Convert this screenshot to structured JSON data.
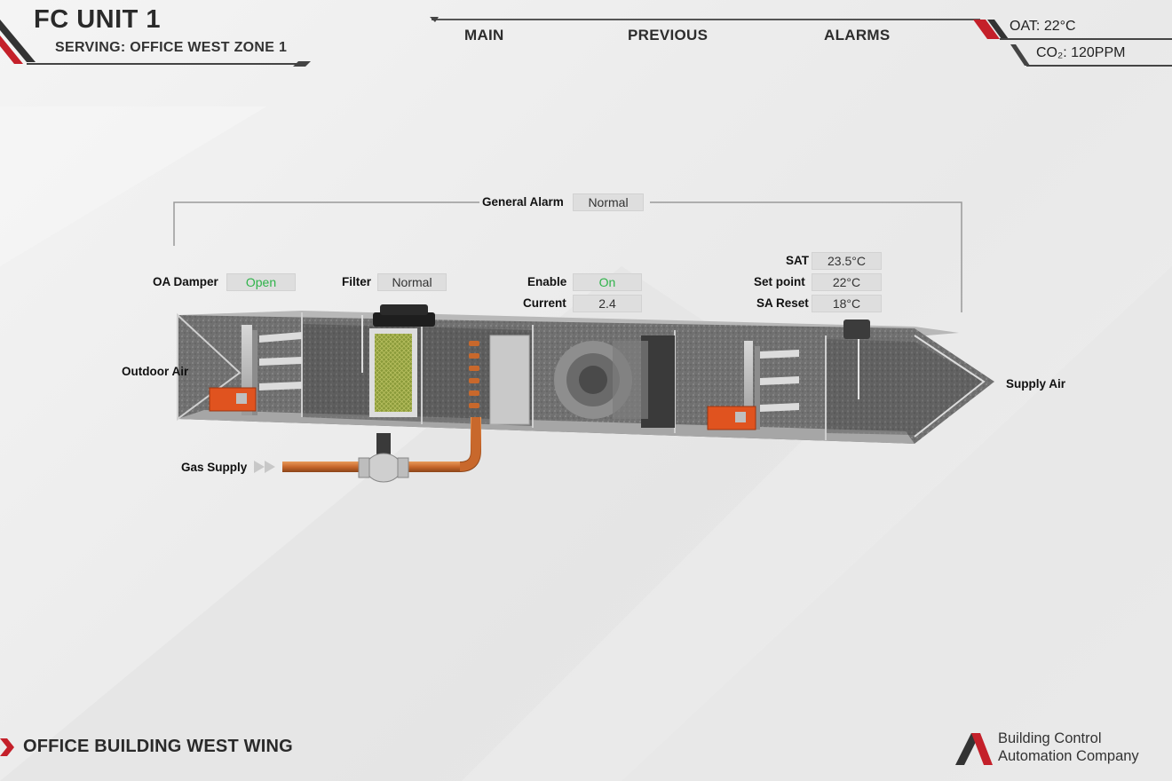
{
  "header": {
    "title": "FC UNIT 1",
    "subtitle": "SERVING: OFFICE WEST ZONE 1"
  },
  "nav": {
    "main": "MAIN",
    "previous": "PREVIOUS",
    "alarms": "ALARMS"
  },
  "status": {
    "oat": "OAT:  22°C",
    "co2": "CO₂:  120PPM"
  },
  "unit": {
    "general_alarm": {
      "label": "General Alarm",
      "value": "Normal"
    },
    "oa_damper": {
      "label": "OA Damper",
      "value": "Open"
    },
    "filter": {
      "label": "Filter",
      "value": "Normal"
    },
    "enable": {
      "label": "Enable",
      "value": "On"
    },
    "current": {
      "label": "Current",
      "value": "2.4"
    },
    "sat": {
      "label": "SAT",
      "value": "23.5°C"
    },
    "set_point": {
      "label": "Set point",
      "value": "22°C"
    },
    "sa_reset": {
      "label": "SA Reset",
      "value": "18°C"
    },
    "outdoor_air": "Outdoor Air",
    "supply_air": "Supply Air",
    "gas_supply": "Gas Supply"
  },
  "footer": {
    "building": "OFFICE BUILDING WEST WING",
    "company_line1": "Building Control",
    "company_line2": "Automation Company"
  },
  "colors": {
    "accent_red": "#c4202a",
    "status_green": "#2fb34a",
    "pipe_copper": "#c8682c",
    "damper_orange": "#e0531f"
  },
  "icons": [
    "nav-arrow-icon",
    "company-logo-icon",
    "gas-flow-arrow-icon"
  ]
}
